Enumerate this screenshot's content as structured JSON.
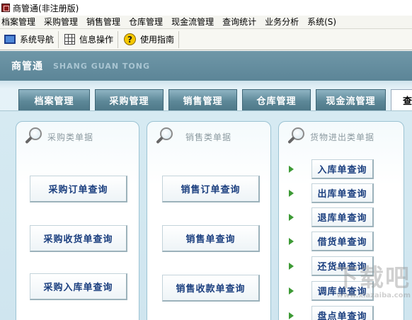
{
  "window": {
    "title": "商管通(非注册版)"
  },
  "menubar": {
    "items": [
      "档案管理",
      "采购管理",
      "销售管理",
      "仓库管理",
      "现金流管理",
      "查询统计",
      "业务分析",
      "系统(S)"
    ]
  },
  "toolbar": {
    "nav_label": "系统导航",
    "info_label": "信息操作",
    "help_label": "使用指南"
  },
  "brand": {
    "cn": "商管通",
    "en": "SHANG GUAN TONG"
  },
  "tabs": [
    "档案管理",
    "采购管理",
    "销售管理",
    "仓库管理",
    "现金流管理",
    "查"
  ],
  "panels": {
    "purchase": {
      "title": "采购类单据",
      "buttons": [
        "采购订单查询",
        "采购收货单查询",
        "采购入库单查询"
      ]
    },
    "sales": {
      "title": "销售类单据",
      "buttons": [
        "销售订单查询",
        "销售单查询",
        "销售收款单查询"
      ]
    },
    "stock": {
      "title": "货物进出类单据",
      "buttons": [
        "入库单查询",
        "出库单查询",
        "退库单查询",
        "借货单查询",
        "还货单查询",
        "调库单查询",
        "盘点单查询"
      ]
    }
  },
  "watermark": {
    "main": "下载吧",
    "sub": "www.xiazaiba.com"
  },
  "colors": {
    "brand_bar": "#5c8597",
    "tab": "#5d8898",
    "button_text": "#1b3f7f",
    "arrow": "#3d9a35"
  },
  "icons": {
    "nav": "monitor-icon",
    "info": "grid-icon",
    "help": "help-icon",
    "panel": "magnifier-icon",
    "row": "arrow-right-icon"
  }
}
